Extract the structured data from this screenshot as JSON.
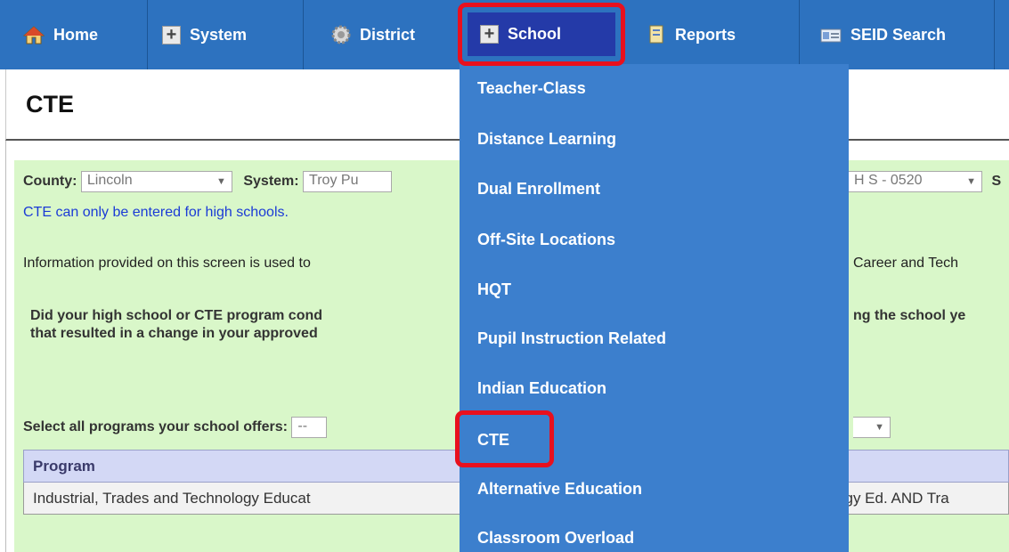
{
  "nav": {
    "home": "Home",
    "system": "System",
    "district": "District",
    "school": "School",
    "reports": "Reports",
    "seid_search": "SEID Search"
  },
  "page": {
    "title": "CTE"
  },
  "filters": {
    "county_label": "County:",
    "county_value": "Lincoln",
    "system_label": "System:",
    "system_value": "Troy Pu",
    "school_value": "H S - 0520",
    "trailing_label": "S"
  },
  "notes": {
    "cte_high_school_only": "CTE can only be entered for high schools.",
    "info_left": "Information provided on this screen is used to",
    "info_right": "Career and Tech",
    "question_line1_left": "Did your high school or CTE program cond",
    "question_line1_right": "ng the school ye",
    "question_line2_left": "that resulted in a change in your approved"
  },
  "programs": {
    "select_label": "Select all programs your school offers:",
    "select_value": "--",
    "table_header": "Program",
    "row_left": "Industrial, Trades and Technology Educat",
    "row_right": "gy Ed. AND Tra"
  },
  "school_menu": {
    "items": [
      "Teacher-Class",
      "Distance Learning",
      "Dual Enrollment",
      "Off-Site Locations",
      "HQT",
      "Pupil Instruction Related",
      "Indian Education",
      "CTE",
      "Alternative Education",
      "Classroom Overload"
    ]
  },
  "colors": {
    "nav_bg": "#2d72bf",
    "dropdown_bg": "#3c7fcd",
    "school_active_bg": "#243aa8",
    "highlight_red": "#e8101e",
    "content_bg": "#d9f7c9"
  },
  "icons": {
    "home": "home-icon",
    "system": "plus-box-icon",
    "district": "gear-icon",
    "school": "plus-box-icon",
    "reports": "document-icon",
    "seid_search": "id-card-icon"
  }
}
